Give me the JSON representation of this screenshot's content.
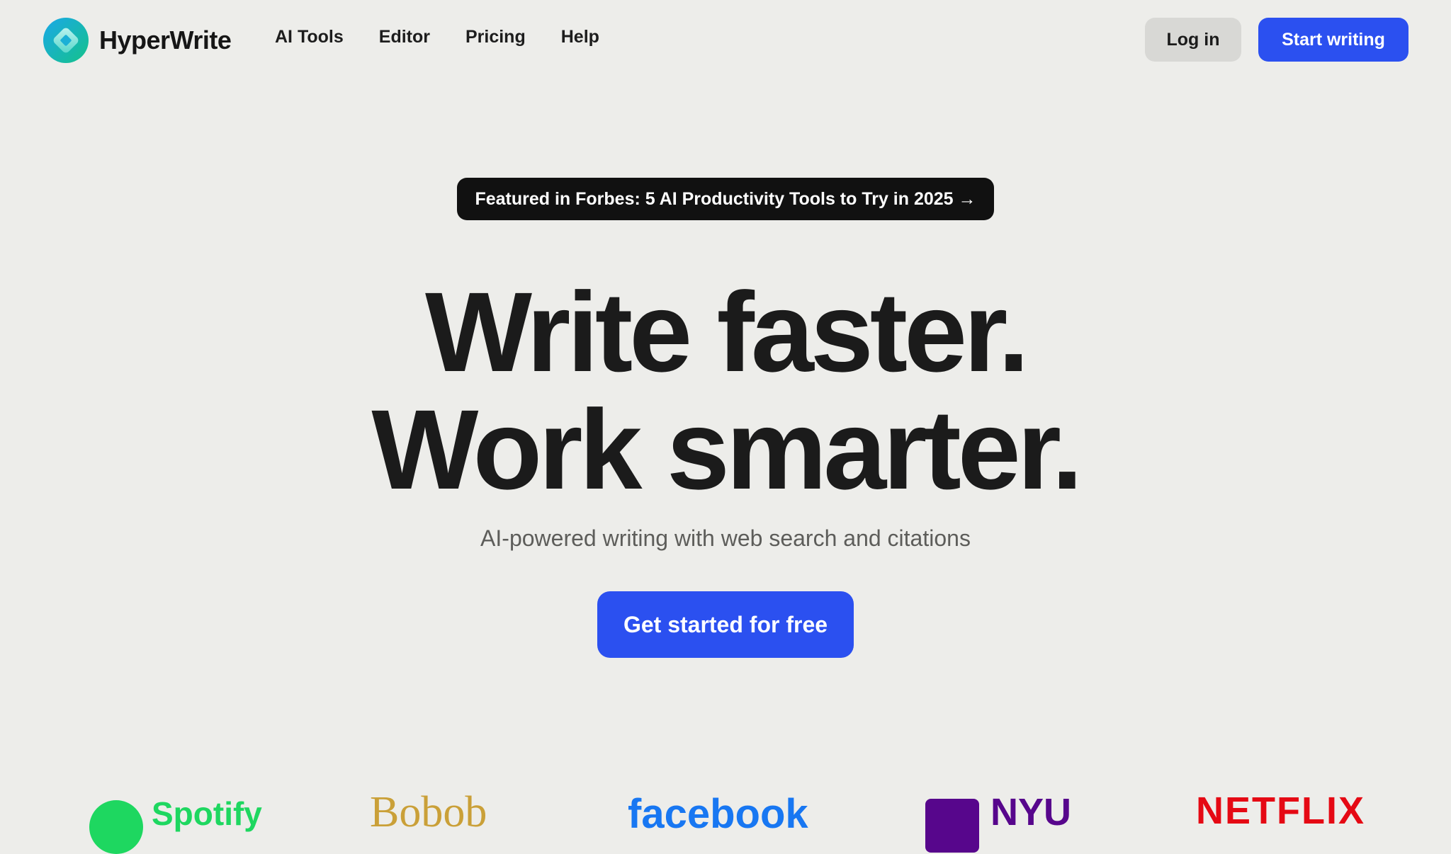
{
  "header": {
    "logo_text": "HyperWrite",
    "nav": [
      "AI Tools",
      "Editor",
      "Pricing",
      "Help"
    ],
    "login_label": "Log in",
    "start_label": "Start writing"
  },
  "hero": {
    "badge": "Featured in Forbes: 5 AI Productivity Tools to Try in 2025 →",
    "title_line1": "Write faster.",
    "title_line2": "Work smarter.",
    "subtitle": "AI-powered writing with web search and citations",
    "cta_label": "Get started for free"
  },
  "logos": {
    "spotify": "Spotify",
    "bobob": "Bobob",
    "facebook": "facebook",
    "nyu": "NYU",
    "netflix": "NETFLIX"
  },
  "colors": {
    "background": "#ededea",
    "accent": "#2b50f0",
    "badge": "#111111"
  }
}
